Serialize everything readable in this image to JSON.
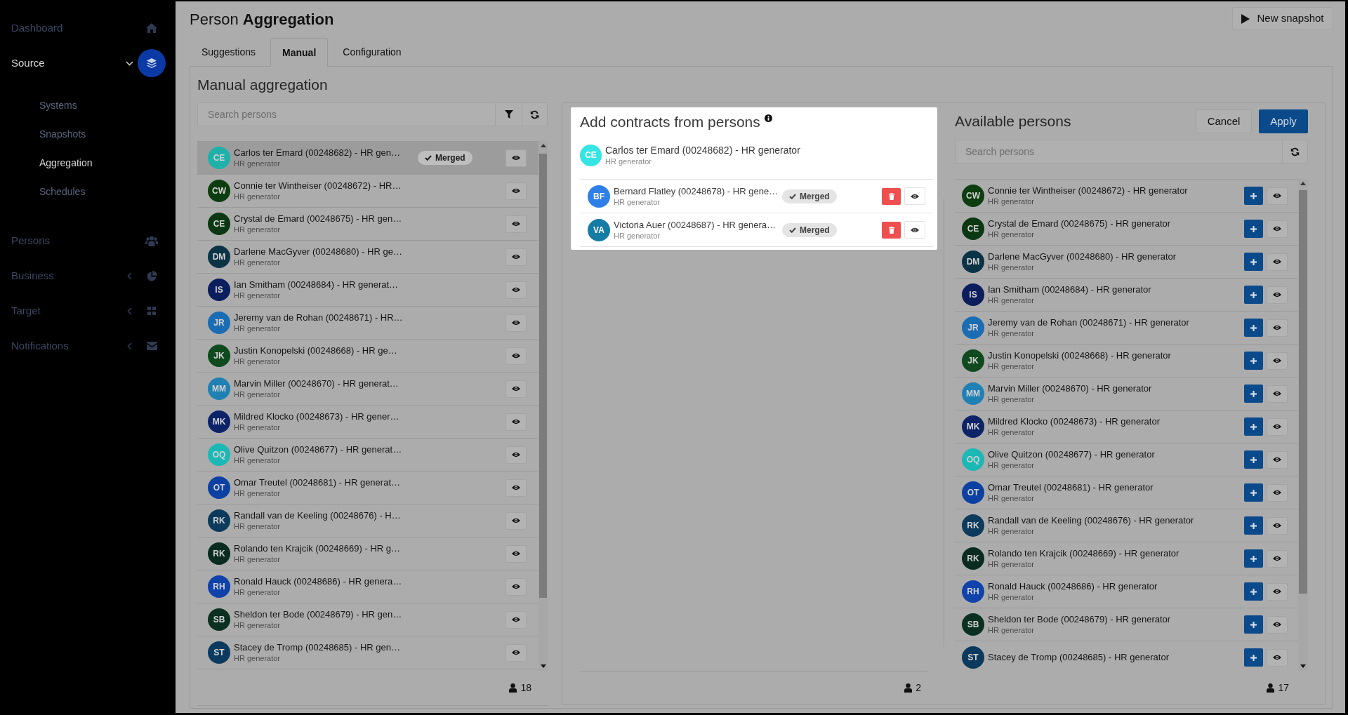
{
  "sidebar": {
    "items": [
      {
        "label": "Dashboard",
        "selected": false
      },
      {
        "label": "Source",
        "selected": true,
        "expanded": true,
        "children": [
          {
            "label": "Systems",
            "selected": false
          },
          {
            "label": "Snapshots",
            "selected": false
          },
          {
            "label": "Aggregation",
            "selected": true
          },
          {
            "label": "Schedules",
            "selected": false
          }
        ]
      },
      {
        "label": "Persons",
        "selected": false
      },
      {
        "label": "Business",
        "selected": false,
        "expanded": false
      },
      {
        "label": "Target",
        "selected": false,
        "expanded": false
      },
      {
        "label": "Notifications",
        "selected": false,
        "expanded": false
      }
    ]
  },
  "header": {
    "title": "Person **Aggregation**",
    "new_snapshot_button": "New snapshot"
  },
  "tabs": [
    {
      "label": "Suggestions",
      "selected": false
    },
    {
      "label": "Manual",
      "selected": true
    },
    {
      "label": "Configuration",
      "selected": false
    }
  ],
  "manual_aggregation": {
    "title": "Manual aggregation",
    "search": {
      "placeholder": "Search persons"
    },
    "persons": [
      {
        "initials": "CE",
        "color": "#1fb0aa",
        "name": "Carlos ter Emard (00248682) - HR gen…",
        "subtitle": "HR generator",
        "badge": "Merged",
        "selected": true
      },
      {
        "initials": "CW",
        "color": "#0c3d10",
        "name": "Connie ter Wintheiser (00248672) - HR…",
        "subtitle": "HR generator",
        "selected": false
      },
      {
        "initials": "CE",
        "color": "#0b3812",
        "name": "Crystal de Emard (00248675) - HR gen…",
        "subtitle": "HR generator",
        "selected": false
      },
      {
        "initials": "DM",
        "color": "#0b3346",
        "name": "Darlene MacGyver (00248680) - HR ge…",
        "subtitle": "HR generator",
        "selected": false
      },
      {
        "initials": "IS",
        "color": "#0a1d5c",
        "name": "Ian Smitham (00248684) - HR generat…",
        "subtitle": "HR generator",
        "selected": false
      },
      {
        "initials": "JR",
        "color": "#1a6cb3",
        "name": "Jeremy van de Rohan (00248671) - HR…",
        "subtitle": "HR generator",
        "selected": false
      },
      {
        "initials": "JK",
        "color": "#0e4a1d",
        "name": "Justin Konopelski (00248668) - HR ge…",
        "subtitle": "HR generator",
        "selected": false
      },
      {
        "initials": "MM",
        "color": "#1e80b3",
        "name": "Marvin Miller (00248670) - HR generat…",
        "subtitle": "HR generator",
        "selected": false
      },
      {
        "initials": "MK",
        "color": "#0c2368",
        "name": "Mildred Klocko (00248673) - HR gener…",
        "subtitle": "HR generator",
        "selected": false
      },
      {
        "initials": "OQ",
        "color": "#1cb8b6",
        "name": "Olive Quitzon (00248677) - HR generat…",
        "subtitle": "HR generator",
        "selected": false
      },
      {
        "initials": "OT",
        "color": "#0c40a3",
        "name": "Omar Treutel (00248681) - HR generat…",
        "subtitle": "HR generator",
        "selected": false
      },
      {
        "initials": "RK",
        "color": "#0c3a5c",
        "name": "Randall van de Keeling (00248676) - H…",
        "subtitle": "HR generator",
        "selected": false
      },
      {
        "initials": "RK",
        "color": "#0a2b1f",
        "name": "Rolando ten Krajcik (00248669) - HR g…",
        "subtitle": "HR generator",
        "selected": false
      },
      {
        "initials": "RH",
        "color": "#0f42aa",
        "name": "Ronald Hauck (00248686) - HR genera…",
        "subtitle": "HR generator",
        "selected": false
      },
      {
        "initials": "SB",
        "color": "#0a3022",
        "name": "Sheldon ter Bode (00248679) - HR gen…",
        "subtitle": "HR generator",
        "selected": false
      },
      {
        "initials": "ST",
        "color": "#0c3a5e",
        "name": "Stacey de Tromp (00248685) - HR gen…",
        "subtitle": "HR generator",
        "selected": false
      }
    ],
    "count": "18"
  },
  "add_contracts": {
    "title": "Add contracts from persons",
    "target": {
      "initials": "CE",
      "color": "#36e4e4",
      "name": "Carlos ter Emard (00248682) - HR generator",
      "subtitle": "HR generator"
    },
    "contracts": [
      {
        "initials": "BF",
        "color": "#2e80e8",
        "name": "Bernard Flatley (00248678) - HR gene…",
        "subtitle": "HR generator",
        "badge": "Merged"
      },
      {
        "initials": "VA",
        "color": "#157ca4",
        "name": "Victoria Auer (00248687) - HR genera…",
        "subtitle": "HR generator",
        "badge": "Merged"
      }
    ],
    "count": "2"
  },
  "available_persons": {
    "title": "Available persons",
    "buttons": [
      {
        "label": "Cancel",
        "kind": "secondary"
      },
      {
        "label": "Apply",
        "kind": "primary"
      }
    ],
    "search": {
      "placeholder": "Search persons"
    },
    "persons": [
      {
        "initials": "CW",
        "color": "#0c3d10",
        "name": "Connie ter Wintheiser (00248672) - HR generator",
        "subtitle": "HR generator"
      },
      {
        "initials": "CE",
        "color": "#0b3812",
        "name": "Crystal de Emard (00248675) - HR generator",
        "subtitle": "HR generator"
      },
      {
        "initials": "DM",
        "color": "#0b3346",
        "name": "Darlene MacGyver (00248680) - HR generator",
        "subtitle": "HR generator"
      },
      {
        "initials": "IS",
        "color": "#0a1d5c",
        "name": "Ian Smitham (00248684) - HR generator",
        "subtitle": "HR generator"
      },
      {
        "initials": "JR",
        "color": "#1a6cb3",
        "name": "Jeremy van de Rohan (00248671) - HR generator",
        "subtitle": "HR generator"
      },
      {
        "initials": "JK",
        "color": "#0e4a1d",
        "name": "Justin Konopelski (00248668) - HR generator",
        "subtitle": "HR generator"
      },
      {
        "initials": "MM",
        "color": "#1e80b3",
        "name": "Marvin Miller (00248670) - HR generator",
        "subtitle": "HR generator"
      },
      {
        "initials": "MK",
        "color": "#0c2368",
        "name": "Mildred Klocko (00248673) - HR generator",
        "subtitle": "HR generator"
      },
      {
        "initials": "OQ",
        "color": "#1cb8b6",
        "name": "Olive Quitzon (00248677) - HR generator",
        "subtitle": "HR generator"
      },
      {
        "initials": "OT",
        "color": "#0c40a3",
        "name": "Omar Treutel (00248681) - HR generator",
        "subtitle": "HR generator"
      },
      {
        "initials": "RK",
        "color": "#0c3a5c",
        "name": "Randall van de Keeling (00248676) - HR generator",
        "subtitle": "HR generator"
      },
      {
        "initials": "RK",
        "color": "#0a2b1f",
        "name": "Rolando ten Krajcik (00248669) - HR generator",
        "subtitle": "HR generator"
      },
      {
        "initials": "RH",
        "color": "#0f42aa",
        "name": "Ronald Hauck (00248686) - HR generator",
        "subtitle": "HR generator"
      },
      {
        "initials": "SB",
        "color": "#0a3022",
        "name": "Sheldon ter Bode (00248679) - HR generator",
        "subtitle": "HR generator"
      },
      {
        "initials": "ST",
        "color": "#0c3a5e",
        "name": "Stacey de Tromp (00248685) - HR generator"
      }
    ],
    "count": "17"
  }
}
